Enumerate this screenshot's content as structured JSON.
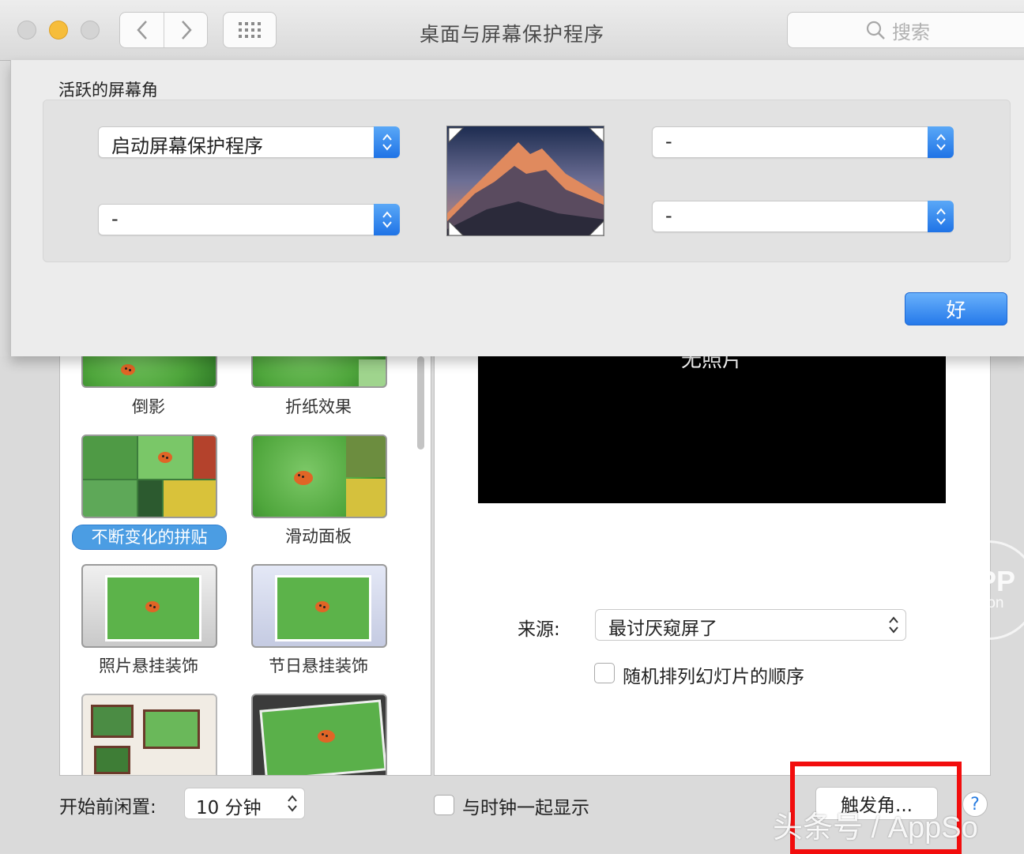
{
  "window": {
    "title": "桌面与屏幕保护程序"
  },
  "search": {
    "placeholder": "搜索"
  },
  "sheet": {
    "section_label": "活跃的屏幕角",
    "corners": {
      "top_left": "启动屏幕保护程序",
      "top_right": "-",
      "bottom_left": "-",
      "bottom_right": "-"
    },
    "ok_label": "好"
  },
  "screensavers": [
    {
      "label": "倒影",
      "selected": false
    },
    {
      "label": "折纸效果",
      "selected": false
    },
    {
      "label": "不断变化的拼贴",
      "selected": true
    },
    {
      "label": "滑动面板",
      "selected": false
    },
    {
      "label": "照片悬挂装饰",
      "selected": false
    },
    {
      "label": "节日悬挂装饰",
      "selected": false
    }
  ],
  "preview": {
    "no_photos": "无照片",
    "source_label": "来源:",
    "source_value": "最讨厌窥屏了",
    "shuffle_label": "随机排列幻灯片的顺序"
  },
  "bottom": {
    "idle_label": "开始前闲置:",
    "idle_value": "10 分钟",
    "clock_label": "与时钟一起显示",
    "hot_corners_label": "触发角...",
    "help_label": "?"
  },
  "watermark": {
    "circle_top": "APP",
    "circle_bottom": "solution",
    "text": "头条号 / AppSo"
  },
  "colors": {
    "accent": "#2579ea",
    "highlight_box": "#f20d0d"
  }
}
